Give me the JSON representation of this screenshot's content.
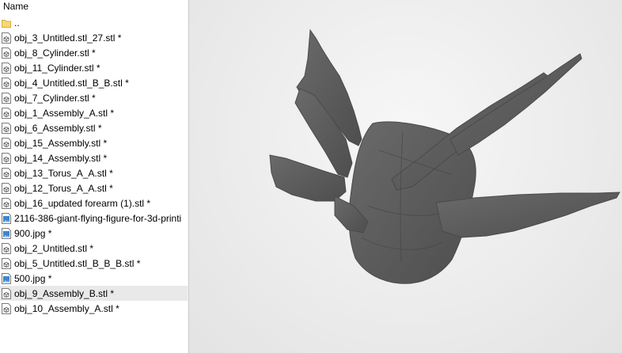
{
  "file_panel": {
    "column_header": "Name",
    "items": [
      {
        "label": "..",
        "icon": "folder-icon"
      },
      {
        "label": "obj_3_Untitled.stl_27.stl *",
        "icon": "stl-file-icon"
      },
      {
        "label": "obj_8_Cylinder.stl *",
        "icon": "stl-file-icon"
      },
      {
        "label": "obj_11_Cylinder.stl *",
        "icon": "stl-file-icon"
      },
      {
        "label": "obj_4_Untitled.stl_B_B.stl *",
        "icon": "stl-file-icon"
      },
      {
        "label": "obj_7_Cylinder.stl *",
        "icon": "stl-file-icon"
      },
      {
        "label": "obj_1_Assembly_A.stl *",
        "icon": "stl-file-icon"
      },
      {
        "label": "obj_6_Assembly.stl *",
        "icon": "stl-file-icon"
      },
      {
        "label": "obj_15_Assembly.stl *",
        "icon": "stl-file-icon"
      },
      {
        "label": "obj_14_Assembly.stl *",
        "icon": "stl-file-icon"
      },
      {
        "label": "obj_13_Torus_A_A.stl *",
        "icon": "stl-file-icon"
      },
      {
        "label": "obj_12_Torus_A_A.stl *",
        "icon": "stl-file-icon"
      },
      {
        "label": "obj_16_updated forearm (1).stl *",
        "icon": "stl-file-icon"
      },
      {
        "label": "2116-386-giant-flying-figure-for-3d-printi",
        "icon": "image-file-icon"
      },
      {
        "label": "900.jpg *",
        "icon": "image-file-icon"
      },
      {
        "label": "obj_2_Untitled.stl *",
        "icon": "stl-file-icon"
      },
      {
        "label": "obj_5_Untitled.stl_B_B_B.stl *",
        "icon": "stl-file-icon"
      },
      {
        "label": "500.jpg *",
        "icon": "image-file-icon"
      },
      {
        "label": "obj_9_Assembly_B.stl *",
        "icon": "stl-file-icon",
        "selected": true
      },
      {
        "label": "obj_10_Assembly_A.stl *",
        "icon": "stl-file-icon"
      }
    ]
  },
  "viewport": {
    "model_color": "#5c5c5c",
    "background_color": "#ececec"
  }
}
